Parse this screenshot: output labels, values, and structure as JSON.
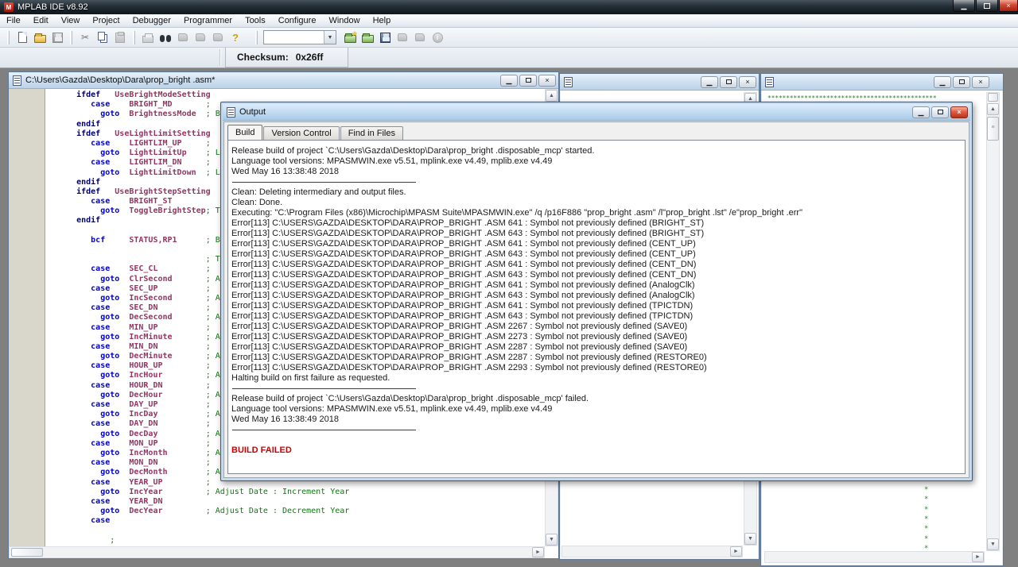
{
  "app": {
    "title": "MPLAB IDE v8.92"
  },
  "menu": {
    "items": [
      "File",
      "Edit",
      "View",
      "Project",
      "Debugger",
      "Programmer",
      "Tools",
      "Configure",
      "Window",
      "Help"
    ]
  },
  "toolbar": {
    "icons": [
      "new-file",
      "open-file",
      "save-file",
      "cut",
      "copy",
      "paste",
      "print",
      "find",
      "checkpoint",
      "bookmark-prev",
      "bookmark-next",
      "help",
      "new-project",
      "open-project",
      "save-workspace",
      "build",
      "program-target",
      "about"
    ],
    "combo_value": "",
    "checksum_label": "Checksum:",
    "checksum_value": "0x26ff"
  },
  "editor": {
    "title": "C:\\Users\\Gazda\\Desktop\\Dara\\prop_bright .asm*",
    "lines": [
      [
        [
          "     ifdef",
          "k1"
        ],
        [
          "   ",
          "pl"
        ],
        [
          "UseBrightModeSetting",
          "id"
        ]
      ],
      [
        [
          "        case",
          "k2"
        ],
        [
          "    ",
          "pl"
        ],
        [
          "BRIGHT_MD",
          "id"
        ],
        [
          "       ",
          "pl"
        ],
        [
          ";",
          "cm"
        ]
      ],
      [
        [
          "          goto",
          "k2"
        ],
        [
          "  ",
          "pl"
        ],
        [
          "BrightnessMode",
          "id"
        ],
        [
          "  ",
          "pl"
        ],
        [
          "; Br",
          "cm"
        ]
      ],
      [
        [
          "     endif",
          "k1"
        ]
      ],
      [
        [
          "     ifdef",
          "k1"
        ],
        [
          "   ",
          "pl"
        ],
        [
          "UseLightLimitSetting",
          "id"
        ]
      ],
      [
        [
          "        case",
          "k2"
        ],
        [
          "    ",
          "pl"
        ],
        [
          "LIGHTLIM_UP",
          "id"
        ],
        [
          "     ",
          "pl"
        ],
        [
          ";",
          "cm"
        ]
      ],
      [
        [
          "          goto",
          "k2"
        ],
        [
          "  ",
          "pl"
        ],
        [
          "LightLimitUp",
          "id"
        ],
        [
          "    ",
          "pl"
        ],
        [
          "; Li",
          "cm"
        ]
      ],
      [
        [
          "        case",
          "k2"
        ],
        [
          "    ",
          "pl"
        ],
        [
          "LIGHTLIM_DN",
          "id"
        ],
        [
          "     ",
          "pl"
        ],
        [
          ";",
          "cm"
        ]
      ],
      [
        [
          "          goto",
          "k2"
        ],
        [
          "  ",
          "pl"
        ],
        [
          "LightLimitDown",
          "id"
        ],
        [
          "  ",
          "pl"
        ],
        [
          "; Li",
          "cm"
        ]
      ],
      [
        [
          "     endif",
          "k1"
        ]
      ],
      [
        [
          "     ifdef",
          "k1"
        ],
        [
          "   ",
          "pl"
        ],
        [
          "UseBrightStepSetting",
          "id"
        ]
      ],
      [
        [
          "        case",
          "k2"
        ],
        [
          "    ",
          "pl"
        ],
        [
          "BRIGHT_ST",
          "id"
        ]
      ],
      [
        [
          "          goto",
          "k2"
        ],
        [
          "  ",
          "pl"
        ],
        [
          "ToggleBrightStep",
          "id"
        ],
        [
          "; To",
          "cm"
        ]
      ],
      [
        [
          "     endif",
          "k1"
        ]
      ],
      [],
      [
        [
          "        bcf",
          "k2"
        ],
        [
          "     ",
          "pl"
        ],
        [
          "STATUS,RP1",
          "id"
        ],
        [
          "      ",
          "pl"
        ],
        [
          "; Ba",
          "cm"
        ]
      ],
      [],
      [
        [
          "                                ",
          "pl"
        ],
        [
          "; Ti",
          "cm"
        ]
      ],
      [
        [
          "        case",
          "k2"
        ],
        [
          "    ",
          "pl"
        ],
        [
          "SEC_CL",
          "id"
        ],
        [
          "          ",
          "pl"
        ],
        [
          ";",
          "cm"
        ]
      ],
      [
        [
          "          goto",
          "k2"
        ],
        [
          "  ",
          "pl"
        ],
        [
          "ClrSecond",
          "id"
        ],
        [
          "       ",
          "pl"
        ],
        [
          "; Ad",
          "cm"
        ]
      ],
      [
        [
          "        case",
          "k2"
        ],
        [
          "    ",
          "pl"
        ],
        [
          "SEC_UP",
          "id"
        ],
        [
          "          ",
          "pl"
        ],
        [
          ";",
          "cm"
        ]
      ],
      [
        [
          "          goto",
          "k2"
        ],
        [
          "  ",
          "pl"
        ],
        [
          "IncSecond",
          "id"
        ],
        [
          "       ",
          "pl"
        ],
        [
          "; Ad",
          "cm"
        ]
      ],
      [
        [
          "        case",
          "k2"
        ],
        [
          "    ",
          "pl"
        ],
        [
          "SEC_DN",
          "id"
        ],
        [
          "          ",
          "pl"
        ],
        [
          ";",
          "cm"
        ]
      ],
      [
        [
          "          goto",
          "k2"
        ],
        [
          "  ",
          "pl"
        ],
        [
          "DecSecond",
          "id"
        ],
        [
          "       ",
          "pl"
        ],
        [
          "; Ad",
          "cm"
        ]
      ],
      [
        [
          "        case",
          "k2"
        ],
        [
          "    ",
          "pl"
        ],
        [
          "MIN_UP",
          "id"
        ],
        [
          "          ",
          "pl"
        ],
        [
          ";",
          "cm"
        ]
      ],
      [
        [
          "          goto",
          "k2"
        ],
        [
          "  ",
          "pl"
        ],
        [
          "IncMinute",
          "id"
        ],
        [
          "       ",
          "pl"
        ],
        [
          "; Ad",
          "cm"
        ]
      ],
      [
        [
          "        case",
          "k2"
        ],
        [
          "    ",
          "pl"
        ],
        [
          "MIN_DN",
          "id"
        ],
        [
          "          ",
          "pl"
        ],
        [
          ";",
          "cm"
        ]
      ],
      [
        [
          "          goto",
          "k2"
        ],
        [
          "  ",
          "pl"
        ],
        [
          "DecMinute",
          "id"
        ],
        [
          "       ",
          "pl"
        ],
        [
          "; Ad",
          "cm"
        ]
      ],
      [
        [
          "        case",
          "k2"
        ],
        [
          "    ",
          "pl"
        ],
        [
          "HOUR_UP",
          "id"
        ],
        [
          "         ",
          "pl"
        ],
        [
          ";",
          "cm"
        ]
      ],
      [
        [
          "          goto",
          "k2"
        ],
        [
          "  ",
          "pl"
        ],
        [
          "IncHour",
          "id"
        ],
        [
          "         ",
          "pl"
        ],
        [
          "; Ad",
          "cm"
        ]
      ],
      [
        [
          "        case",
          "k2"
        ],
        [
          "    ",
          "pl"
        ],
        [
          "HOUR_DN",
          "id"
        ],
        [
          "         ",
          "pl"
        ],
        [
          ";",
          "cm"
        ]
      ],
      [
        [
          "          goto",
          "k2"
        ],
        [
          "  ",
          "pl"
        ],
        [
          "DecHour",
          "id"
        ],
        [
          "         ",
          "pl"
        ],
        [
          "; Ad",
          "cm"
        ]
      ],
      [
        [
          "        case",
          "k2"
        ],
        [
          "    ",
          "pl"
        ],
        [
          "DAY_UP",
          "id"
        ],
        [
          "          ",
          "pl"
        ],
        [
          ";",
          "cm"
        ]
      ],
      [
        [
          "          goto",
          "k2"
        ],
        [
          "  ",
          "pl"
        ],
        [
          "IncDay",
          "id"
        ],
        [
          "          ",
          "pl"
        ],
        [
          "; Ad",
          "cm"
        ]
      ],
      [
        [
          "        case",
          "k2"
        ],
        [
          "    ",
          "pl"
        ],
        [
          "DAY_DN",
          "id"
        ],
        [
          "          ",
          "pl"
        ],
        [
          ";",
          "cm"
        ]
      ],
      [
        [
          "          goto",
          "k2"
        ],
        [
          "  ",
          "pl"
        ],
        [
          "DecDay",
          "id"
        ],
        [
          "          ",
          "pl"
        ],
        [
          "; Ad",
          "cm"
        ]
      ],
      [
        [
          "        case",
          "k2"
        ],
        [
          "    ",
          "pl"
        ],
        [
          "MON_UP",
          "id"
        ],
        [
          "          ",
          "pl"
        ],
        [
          ";",
          "cm"
        ]
      ],
      [
        [
          "          goto",
          "k2"
        ],
        [
          "  ",
          "pl"
        ],
        [
          "IncMonth",
          "id"
        ],
        [
          "        ",
          "pl"
        ],
        [
          "; Ad",
          "cm"
        ]
      ],
      [
        [
          "        case",
          "k2"
        ],
        [
          "    ",
          "pl"
        ],
        [
          "MON_DN",
          "id"
        ],
        [
          "          ",
          "pl"
        ],
        [
          ";",
          "cm"
        ]
      ],
      [
        [
          "          goto",
          "k2"
        ],
        [
          "  ",
          "pl"
        ],
        [
          "DecMonth",
          "id"
        ],
        [
          "        ",
          "pl"
        ],
        [
          "; Ad",
          "cm"
        ]
      ],
      [
        [
          "        case",
          "k2"
        ],
        [
          "    ",
          "pl"
        ],
        [
          "YEAR_UP",
          "id"
        ],
        [
          "         ",
          "pl"
        ],
        [
          ";",
          "cm"
        ]
      ],
      [
        [
          "          goto",
          "k2"
        ],
        [
          "  ",
          "pl"
        ],
        [
          "IncYear",
          "id"
        ],
        [
          "         ",
          "pl"
        ],
        [
          "; Adjust Date : Increment Year",
          "cm"
        ]
      ],
      [
        [
          "        case",
          "k2"
        ],
        [
          "    ",
          "pl"
        ],
        [
          "YEAR_DN",
          "id"
        ]
      ],
      [
        [
          "          goto",
          "k2"
        ],
        [
          "  ",
          "pl"
        ],
        [
          "DecYear",
          "id"
        ],
        [
          "         ",
          "pl"
        ],
        [
          "; Adjust Date : Decrement Year",
          "cm"
        ]
      ],
      [
        [
          "        case",
          "k2"
        ]
      ],
      [],
      [
        [
          "            ",
          "pl"
        ],
        [
          ";",
          "cm"
        ]
      ]
    ]
  },
  "output": {
    "title": "Output",
    "tabs": [
      "Build",
      "Version Control",
      "Find in Files"
    ],
    "active_tab": "Build",
    "lines": [
      {
        "t": "Release build of project `C:\\Users\\Gazda\\Desktop\\Dara\\prop_bright .disposable_mcp' started.",
        "y": "n"
      },
      {
        "t": "Language tool versions: MPASMWIN.exe v5.51, mplink.exe v4.49, mplib.exe v4.49",
        "y": "n"
      },
      {
        "t": "Wed May 16 13:38:48 2018",
        "y": "n"
      },
      {
        "t": "",
        "y": "rule"
      },
      {
        "t": "Clean: Deleting intermediary and output files.",
        "y": "n"
      },
      {
        "t": "Clean: Done.",
        "y": "n"
      },
      {
        "t": "Executing: \"C:\\Program Files (x86)\\Microchip\\MPASM Suite\\MPASMWIN.exe\" /q /p16F886 \"prop_bright .asm\" /l\"prop_bright .lst\" /e\"prop_bright .err\"",
        "y": "n"
      },
      {
        "t": "Error[113]   C:\\USERS\\GAZDA\\DESKTOP\\DARA\\PROP_BRIGHT .ASM 641 : Symbol not previously defined (BRIGHT_ST)",
        "y": "n"
      },
      {
        "t": "Error[113]   C:\\USERS\\GAZDA\\DESKTOP\\DARA\\PROP_BRIGHT .ASM 643 : Symbol not previously defined (BRIGHT_ST)",
        "y": "n"
      },
      {
        "t": "Error[113]   C:\\USERS\\GAZDA\\DESKTOP\\DARA\\PROP_BRIGHT .ASM 641 : Symbol not previously defined (CENT_UP)",
        "y": "n"
      },
      {
        "t": "Error[113]   C:\\USERS\\GAZDA\\DESKTOP\\DARA\\PROP_BRIGHT .ASM 643 : Symbol not previously defined (CENT_UP)",
        "y": "n"
      },
      {
        "t": "Error[113]   C:\\USERS\\GAZDA\\DESKTOP\\DARA\\PROP_BRIGHT .ASM 641 : Symbol not previously defined (CENT_DN)",
        "y": "n"
      },
      {
        "t": "Error[113]   C:\\USERS\\GAZDA\\DESKTOP\\DARA\\PROP_BRIGHT .ASM 643 : Symbol not previously defined (CENT_DN)",
        "y": "n"
      },
      {
        "t": "Error[113]   C:\\USERS\\GAZDA\\DESKTOP\\DARA\\PROP_BRIGHT .ASM 641 : Symbol not previously defined (AnalogClk)",
        "y": "n"
      },
      {
        "t": "Error[113]   C:\\USERS\\GAZDA\\DESKTOP\\DARA\\PROP_BRIGHT .ASM 643 : Symbol not previously defined (AnalogClk)",
        "y": "n"
      },
      {
        "t": "Error[113]   C:\\USERS\\GAZDA\\DESKTOP\\DARA\\PROP_BRIGHT .ASM 641 : Symbol not previously defined (TPICTDN)",
        "y": "n"
      },
      {
        "t": "Error[113]   C:\\USERS\\GAZDA\\DESKTOP\\DARA\\PROP_BRIGHT .ASM 643 : Symbol not previously defined (TPICTDN)",
        "y": "n"
      },
      {
        "t": "Error[113]   C:\\USERS\\GAZDA\\DESKTOP\\DARA\\PROP_BRIGHT .ASM 2267 : Symbol not previously defined (SAVE0)",
        "y": "n"
      },
      {
        "t": "Error[113]   C:\\USERS\\GAZDA\\DESKTOP\\DARA\\PROP_BRIGHT .ASM 2273 : Symbol not previously defined (SAVE0)",
        "y": "n"
      },
      {
        "t": "Error[113]   C:\\USERS\\GAZDA\\DESKTOP\\DARA\\PROP_BRIGHT .ASM 2287 : Symbol not previously defined (SAVE0)",
        "y": "n"
      },
      {
        "t": "Error[113]   C:\\USERS\\GAZDA\\DESKTOP\\DARA\\PROP_BRIGHT .ASM 2287 : Symbol not previously defined (RESTORE0)",
        "y": "n"
      },
      {
        "t": "Error[113]   C:\\USERS\\GAZDA\\DESKTOP\\DARA\\PROP_BRIGHT .ASM 2293 : Symbol not previously defined (RESTORE0)",
        "y": "n"
      },
      {
        "t": "Halting build on first failure as requested.",
        "y": "n"
      },
      {
        "t": "",
        "y": "rule"
      },
      {
        "t": "Release build of project `C:\\Users\\Gazda\\Desktop\\Dara\\prop_bright .disposable_mcp' failed.",
        "y": "n"
      },
      {
        "t": "Language tool versions: MPASMWIN.exe v5.51, mplink.exe v4.49, mplib.exe v4.49",
        "y": "n"
      },
      {
        "t": "Wed May 16 13:38:49 2018",
        "y": "n"
      },
      {
        "t": "",
        "y": "rule"
      },
      {
        "t": "",
        "y": "blank"
      },
      {
        "t": "BUILD FAILED",
        "y": "fail"
      }
    ]
  },
  "window3": {
    "stars_top": "**********************************************",
    "side_stars": [
      "*",
      "*",
      "*",
      "*",
      "*",
      "*",
      "*"
    ]
  },
  "colors": {
    "build_failed": "#cc0000",
    "comment_green": "#0e7a0e",
    "keyword_blue": "#0000cd",
    "directive_navy": "#00007a",
    "symbol_purple": "#993366"
  }
}
